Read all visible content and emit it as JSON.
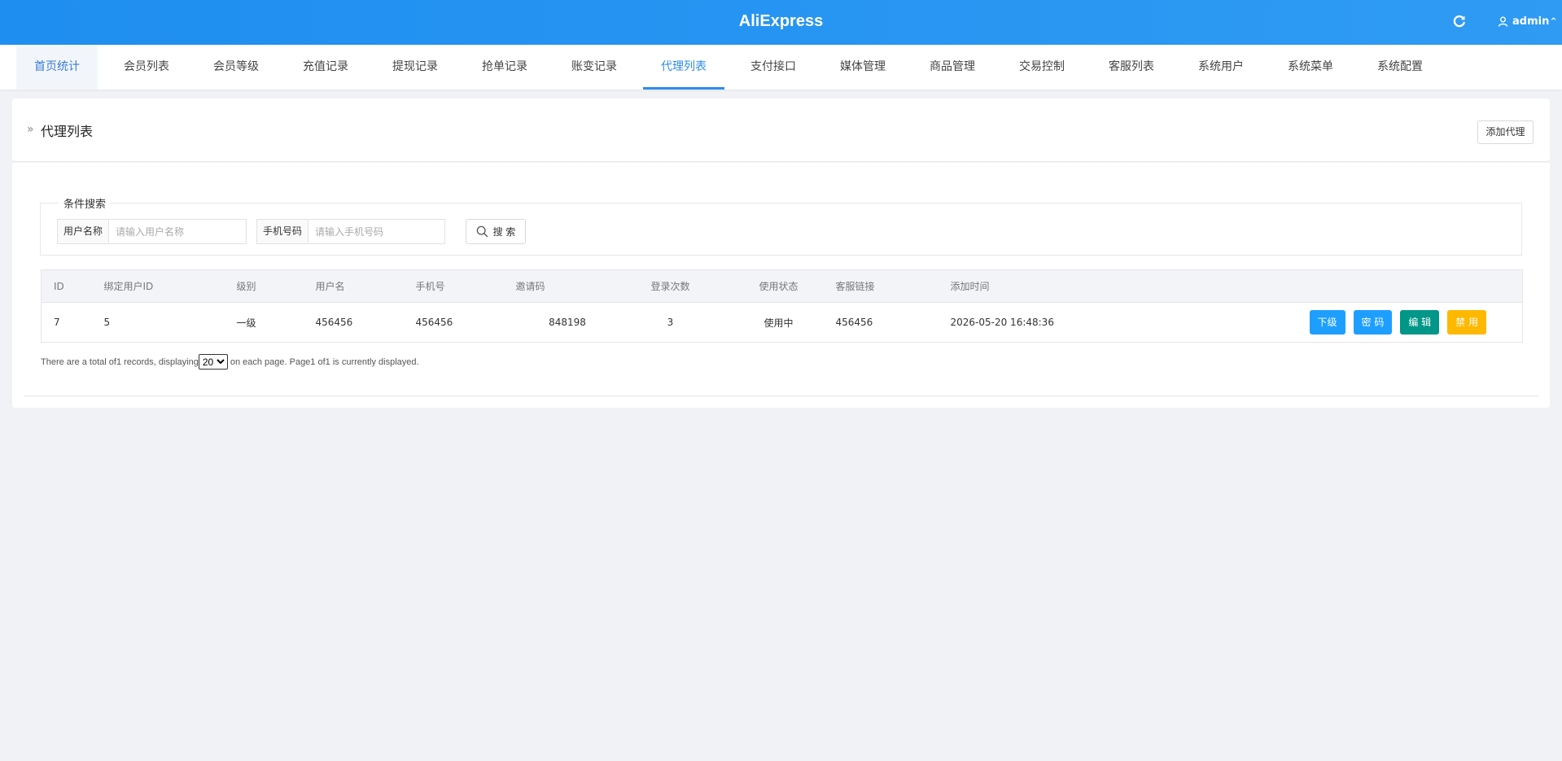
{
  "app": {
    "title": "AliExpress",
    "username": "admin",
    "refresh_icon": "refresh-icon",
    "user_icon": "user-icon"
  },
  "nav": {
    "items": [
      {
        "label": "首页统计"
      },
      {
        "label": "会员列表"
      },
      {
        "label": "会员等级"
      },
      {
        "label": "充值记录"
      },
      {
        "label": "提现记录"
      },
      {
        "label": "抢单记录"
      },
      {
        "label": "账变记录"
      },
      {
        "label": "代理列表"
      },
      {
        "label": "支付接口"
      },
      {
        "label": "媒体管理"
      },
      {
        "label": "商品管理"
      },
      {
        "label": "交易控制"
      },
      {
        "label": "客服列表"
      },
      {
        "label": "系统用户"
      },
      {
        "label": "系统菜单"
      },
      {
        "label": "系统配置"
      }
    ],
    "active_index": 7
  },
  "page": {
    "title": "代理列表",
    "add_button": "添加代理"
  },
  "search": {
    "legend": "条件搜索",
    "username_label": "用户名称",
    "username_placeholder": "请输入用户名称",
    "username_value": "",
    "phone_label": "手机号码",
    "phone_placeholder": "请输入手机号码",
    "phone_value": "",
    "search_button": "搜 索"
  },
  "table": {
    "headers": [
      "ID",
      "绑定用户ID",
      "级别",
      "用户名",
      "手机号",
      "邀请码",
      "登录次数",
      "使用状态",
      "客服链接",
      "添加时间",
      ""
    ],
    "rows": [
      {
        "id": "7",
        "bound_user_id": "5",
        "level": "一级",
        "username": "456456",
        "phone": "456456",
        "invite_code": "848198",
        "login_count": "3",
        "status": "使用中",
        "service_link": "456456",
        "added_at": "2026-05-20 16:48:36",
        "actions": {
          "sub": "下级",
          "password": "密 码",
          "edit": "编 辑",
          "disable": "禁 用"
        }
      }
    ]
  },
  "pager": {
    "text_before": "There are a total of1 records, displaying",
    "page_size": "20",
    "text_after": " on each page. Page1 of1 is currently displayed."
  },
  "colors": {
    "accent": "#2d8cf0",
    "header": "#1e8ef0",
    "btn_blue": "#1e9fff",
    "btn_green": "#009688",
    "btn_yellow": "#ffb800",
    "status_on": "#13a10e"
  }
}
